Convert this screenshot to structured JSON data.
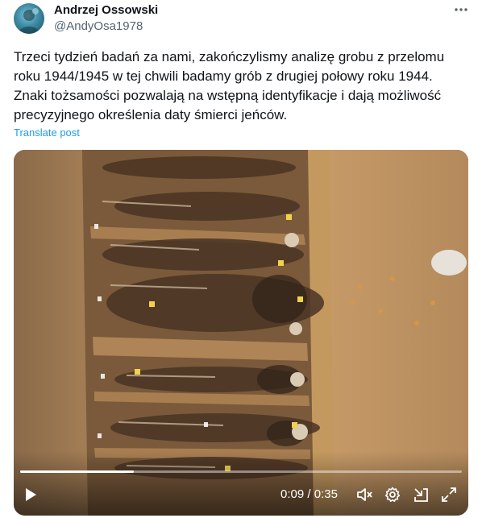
{
  "author": {
    "display_name": "Andrzej Ossowski",
    "handle": "@AndyOsa1978",
    "avatar_icon": "profile-avatar"
  },
  "more_icon": "more-horizontal-icon",
  "post": {
    "lines": [
      "Trzeci tydzień badań za nami, zakończylismy analizę grobu z przelomu",
      "roku 1944/1945 w tej chwili badamy grób z drugiej połowy roku 1944.",
      "Znaki tożsamości pozwalają na wstępną identyfikacje i dają możliwość",
      "precyzyjnego określenia daty śmierci jeńców."
    ],
    "translate_label": "Translate post"
  },
  "video": {
    "current_time": "0:09",
    "separator": " / ",
    "duration": "0:35",
    "progress": 0.257,
    "icons": {
      "play": "play-icon",
      "mute": "volume-muted-icon",
      "settings": "gear-icon",
      "pip": "picture-in-picture-icon",
      "fullscreen": "fullscreen-icon"
    }
  },
  "colors": {
    "link": "#1d9bf0",
    "secondary_text": "#536471",
    "soil": "#b98e5c",
    "trench": "#7a5a3a"
  }
}
